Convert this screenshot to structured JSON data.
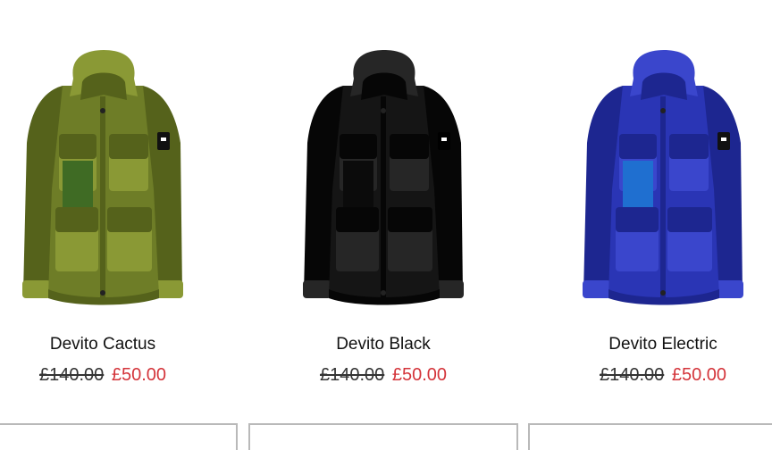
{
  "products": [
    {
      "name": "Devito Cactus",
      "original_price": "£140.00",
      "sale_price": "£50.00",
      "colors": {
        "body": "#6e7d27",
        "shade": "#55621b",
        "light": "#8a9935",
        "mesh": "#3f6b24",
        "patch": "#111111"
      }
    },
    {
      "name": "Devito Black",
      "original_price": "£140.00",
      "sale_price": "£50.00",
      "colors": {
        "body": "#151515",
        "shade": "#060606",
        "light": "#262626",
        "mesh": "#0b0b0b",
        "patch": "#000000"
      }
    },
    {
      "name": "Devito Electric",
      "original_price": "£140.00",
      "sale_price": "£50.00",
      "colors": {
        "body": "#2a35b5",
        "shade": "#1d2690",
        "light": "#3a46cc",
        "mesh": "#1f6fd0",
        "patch": "#111111"
      }
    }
  ],
  "colors": {
    "sale_price": "#d4343a",
    "border": "#b9b9b9"
  }
}
